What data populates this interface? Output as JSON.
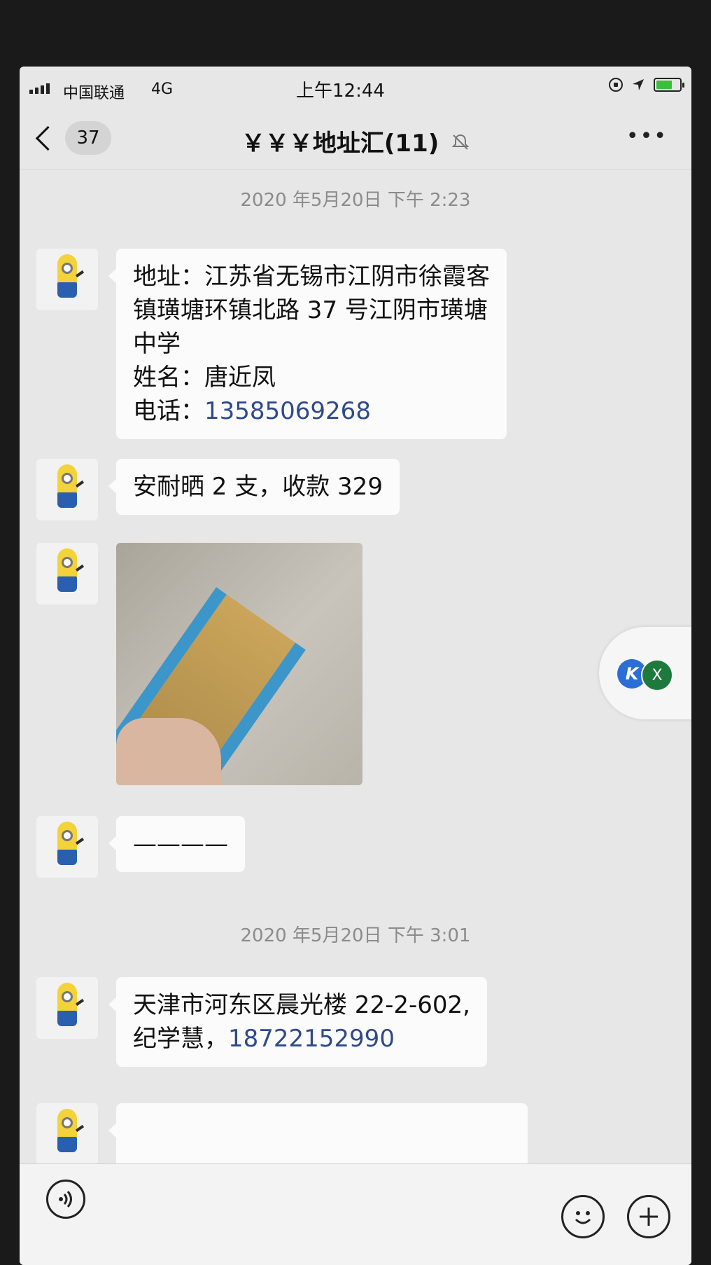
{
  "status_bar": {
    "carrier": "中国联通",
    "network": "4G",
    "time": "上午12:44",
    "battery_color": "#3bbf3b"
  },
  "header": {
    "back_icon": "chevron-left-icon",
    "unread_count": "37",
    "title": "￥￥￥地址汇(11)",
    "mute_icon": "bell-off-icon",
    "more_label": "•••"
  },
  "messages": {
    "timestamp_1": "2020 年5月20日 下午 2:23",
    "msg1_line1": "地址：江苏省无锡市江阴市徐霞客",
    "msg1_line2": "镇璜塘环镇北路 37 号江阴市璜塘",
    "msg1_line3": "中学",
    "msg1_line4": "姓名：唐近凤",
    "msg1_phone_label": "电话：",
    "msg1_phone": "13585069268",
    "msg2": "安耐晒 2 支，收款 329",
    "msg4": "————",
    "timestamp_2": "2020 年5月20日 下午 3:01",
    "msg5_line1": "天津市河东区晨光楼 22-2-602,",
    "msg5_line2_prefix": "纪学慧，",
    "msg5_phone": "18722152990"
  },
  "float_panel": {
    "app1_label": "K",
    "app2_label": "X"
  },
  "input_bar": {
    "voice_icon": "voice-icon",
    "emoji_icon": "emoji-icon",
    "plus_icon": "plus-icon"
  },
  "colors": {
    "link": "#2f4a8a",
    "bubble": "#fbfbfb",
    "background": "#e7e7e7"
  }
}
